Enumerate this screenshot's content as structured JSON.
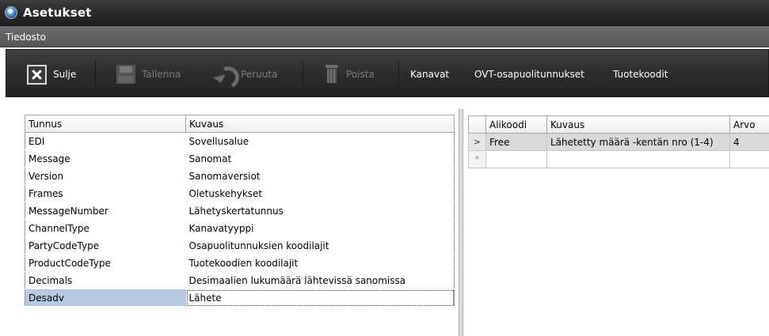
{
  "window": {
    "title": "Asetukset",
    "icon": "globe-icon"
  },
  "menu": {
    "items": [
      "Tiedosto"
    ]
  },
  "toolbar": {
    "close": "Sulje",
    "save": "Tallenna",
    "undo": "Peruuta",
    "delete": "Poista",
    "channels": "Kanavat",
    "ovt": "OVT-osapuolitunnukset",
    "product_codes": "Tuotekoodit"
  },
  "left_table": {
    "headers": [
      "Tunnus",
      "Kuvaus"
    ],
    "rows": [
      [
        "EDI",
        "Sovellusalue"
      ],
      [
        "Message",
        "Sanomat"
      ],
      [
        "Version",
        "Sanomaversiot"
      ],
      [
        "Frames",
        "Oletuskehykset"
      ],
      [
        "MessageNumber",
        "Lähetyskertatunnus"
      ],
      [
        "ChannelType",
        "Kanavatyyppi"
      ],
      [
        "PartyCodeType",
        "Osapuolitunnuksien koodilajit"
      ],
      [
        "ProductCodeType",
        "Tuotekoodien koodilajit"
      ],
      [
        "Decimals",
        "Desimaalien lukumäärä lähtevissä sanomissa"
      ],
      [
        "Desadv",
        "Lähete"
      ]
    ],
    "selected_row": 9
  },
  "right_table": {
    "headers": [
      "Alikoodi",
      "Kuvaus",
      "Arvo"
    ],
    "rows": [
      {
        "marker": ">",
        "cells": [
          "Free",
          "Lähetetty määrä -kentän nro (1-4)",
          "4"
        ]
      },
      {
        "marker": "*",
        "cells": [
          "",
          "",
          ""
        ]
      }
    ]
  },
  "colors": {
    "selection": "#b7c9e0",
    "toolbar": "#2c2c2c",
    "titlebar": "#2b2b2b"
  }
}
